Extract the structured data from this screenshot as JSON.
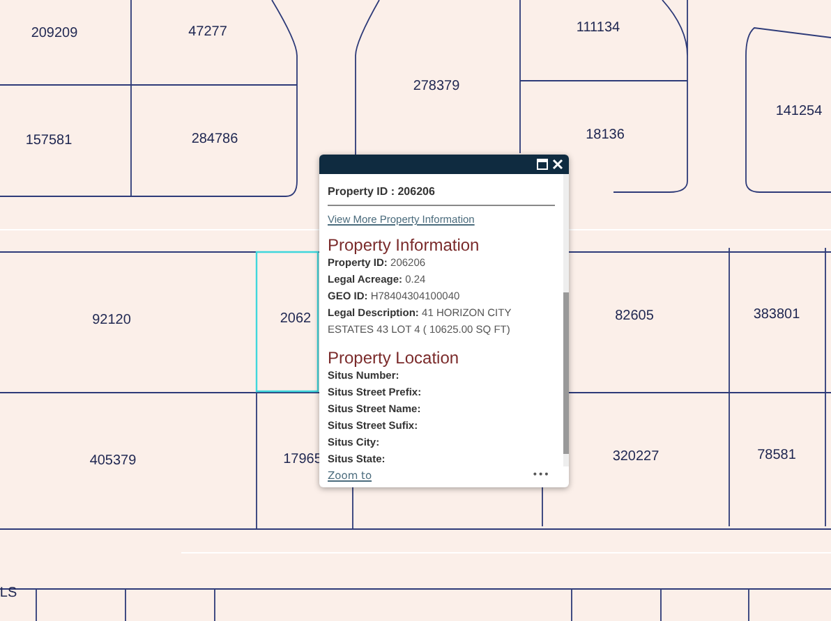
{
  "map": {
    "parcel_labels": [
      "209209",
      "47277",
      "111134",
      "278379",
      "141254",
      "157581",
      "284786",
      "18136",
      "92120",
      "2062",
      "82605",
      "383801",
      "405379",
      "17965",
      "320227",
      "78581",
      "LS"
    ]
  },
  "popup": {
    "title": "Property ID : 206206",
    "link": "View More Property Information",
    "sections": [
      {
        "heading": "Property Information",
        "fields": [
          {
            "label": "Property ID:",
            "value": "206206"
          },
          {
            "label": "Legal Acreage:",
            "value": "0.24"
          },
          {
            "label": "GEO ID:",
            "value": "H78404304100040"
          },
          {
            "label": "Legal Description:",
            "value": "41 HORIZON CITY ESTATES 43 LOT 4 ( 10625.00 SQ FT)"
          }
        ]
      },
      {
        "heading": "Property Location",
        "fields": [
          {
            "label": "Situs Number:"
          },
          {
            "label": "Situs Street Prefix:"
          },
          {
            "label": "Situs Street Name:"
          },
          {
            "label": "Situs Street Sufix:"
          },
          {
            "label": "Situs City:"
          },
          {
            "label": "Situs State:"
          }
        ]
      }
    ],
    "footer_link": "Zoom to",
    "more": "•••"
  }
}
